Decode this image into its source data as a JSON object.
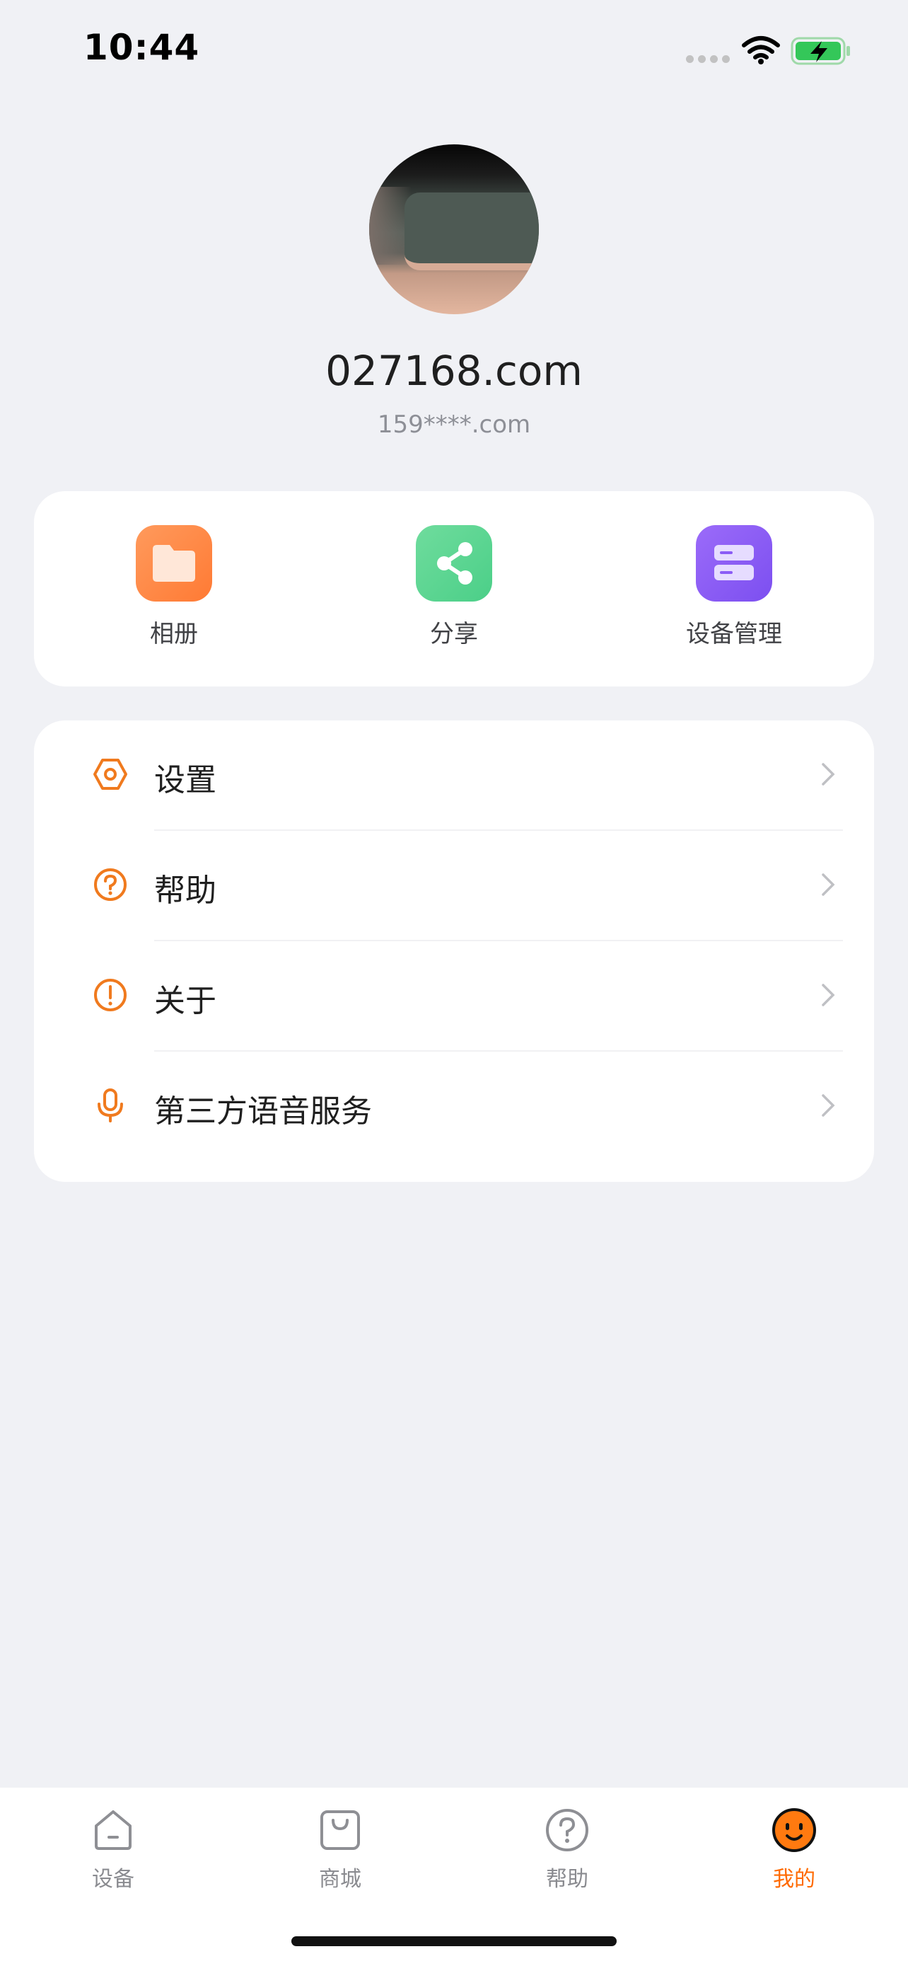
{
  "status_bar": {
    "time": "10:44"
  },
  "profile": {
    "name": "027168.com",
    "email": "159****.com"
  },
  "quick_actions": [
    {
      "label": "相册",
      "icon": "folder-icon",
      "color": "#ff8a45"
    },
    {
      "label": "分享",
      "icon": "share-icon",
      "color": "#4fd18b"
    },
    {
      "label": "设备管理",
      "icon": "storage-icon",
      "color": "#8b5cf6"
    }
  ],
  "menu": [
    {
      "label": "设置",
      "icon": "settings-icon"
    },
    {
      "label": "帮助",
      "icon": "help-icon"
    },
    {
      "label": "关于",
      "icon": "info-icon"
    },
    {
      "label": "第三方语音服务",
      "icon": "microphone-icon"
    }
  ],
  "tabs": [
    {
      "label": "设备",
      "icon": "home-icon",
      "active": false
    },
    {
      "label": "商城",
      "icon": "shop-icon",
      "active": false
    },
    {
      "label": "帮助",
      "icon": "help-icon",
      "active": false
    },
    {
      "label": "我的",
      "icon": "profile-face-icon",
      "active": true
    }
  ],
  "colors": {
    "accent": "#ff6a00",
    "background": "#f0f1f5"
  }
}
